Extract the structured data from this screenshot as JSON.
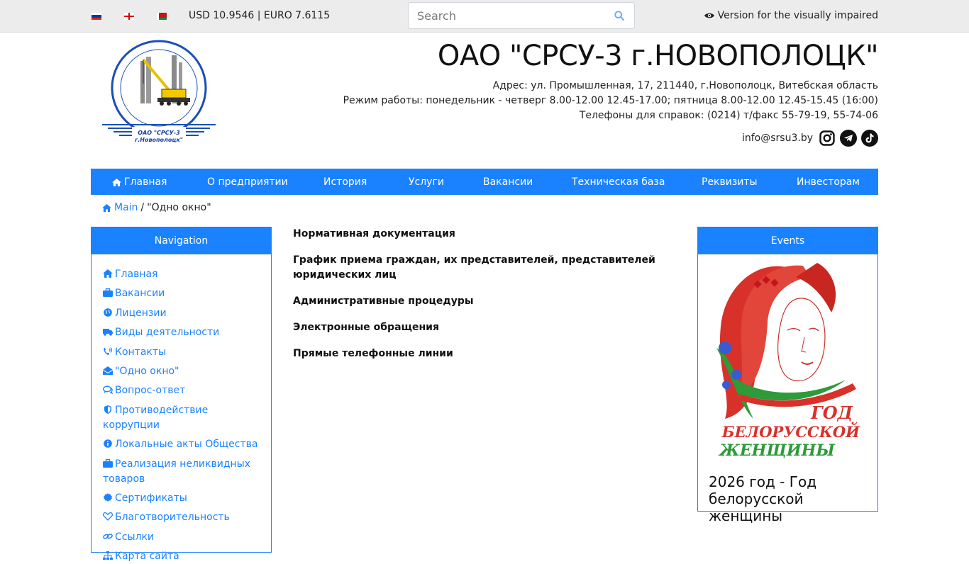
{
  "topbar": {
    "languages": [
      "Русский",
      "English",
      "Беларуская"
    ],
    "currency": "USD 10.9546 | EURO 7.6115",
    "search_placeholder": "Search",
    "visually_impaired": "Version for the visually impaired"
  },
  "header": {
    "logo_text_line1": "ОАО \"СРСУ-3",
    "logo_text_line2": "г.Новополоцк\"",
    "title": "ОАО \"СРСУ-3 г.НОВОПОЛОЦК\"",
    "address": "Адрес: ул. Промышленная, 17, 211440, г.Новополоцк, Витебская область",
    "hours": "Режим работы: понедельник - четверг 8.00-12.00 12.45-17.00; пятница 8.00-12.00 12.45-15.45 (16:00)",
    "phones": "Телефоны для справок: (0214) т/факс 55-79-19, 55-74-06",
    "email": "info@srsu3.by",
    "socials": [
      "instagram-icon",
      "telegram-icon",
      "tiktok-icon"
    ]
  },
  "nav": {
    "items": [
      "Главная",
      "О предприятии",
      "История",
      "Услуги",
      "Вакансии",
      "Техническая база",
      "Реквизиты",
      "Инвесторам"
    ]
  },
  "breadcrumb": {
    "home": "Main",
    "separator": "/",
    "current": "\"Одно окно\""
  },
  "sidebar": {
    "title": "Navigation",
    "items": [
      {
        "label": "Главная",
        "icon": "home-icon"
      },
      {
        "label": "Вакансии",
        "icon": "briefcase-icon"
      },
      {
        "label": "Лицензии",
        "icon": "globe-icon"
      },
      {
        "label": "Виды деятельности",
        "icon": "truck-icon"
      },
      {
        "label": "Контакты",
        "icon": "phone-volume-icon"
      },
      {
        "label": "\"Одно окно\"",
        "icon": "envelope-open-icon"
      },
      {
        "label": "Вопрос-ответ",
        "icon": "comments-icon"
      },
      {
        "label": "Противодействие коррупции",
        "icon": "shield-icon"
      },
      {
        "label": "Локальные акты Общества",
        "icon": "info-circle-icon"
      },
      {
        "label": "Реализация неликвидных товаров",
        "icon": "briefcase-icon"
      },
      {
        "label": "Сертификаты",
        "icon": "certificate-icon"
      },
      {
        "label": "Благотворительность",
        "icon": "heart-icon"
      },
      {
        "label": "Ссылки",
        "icon": "link-icon"
      },
      {
        "label": "Карта сайта",
        "icon": "sitemap-icon"
      }
    ]
  },
  "main": {
    "links": [
      "Нормативная документация",
      "График приема граждан, их представителей, представителей юридических лиц",
      "Административные процедуры",
      "Электронные обращения",
      "Прямые телефонные линии"
    ]
  },
  "events": {
    "title": "Events",
    "image_text": [
      "ГОД",
      "БЕЛОРУССКОЙ",
      "ЖЕНЩИНЫ"
    ],
    "caption": "2026 год - Год белорусской женщины"
  },
  "colors": {
    "accent": "#1a82ff",
    "topbar_bg": "#ececec"
  }
}
